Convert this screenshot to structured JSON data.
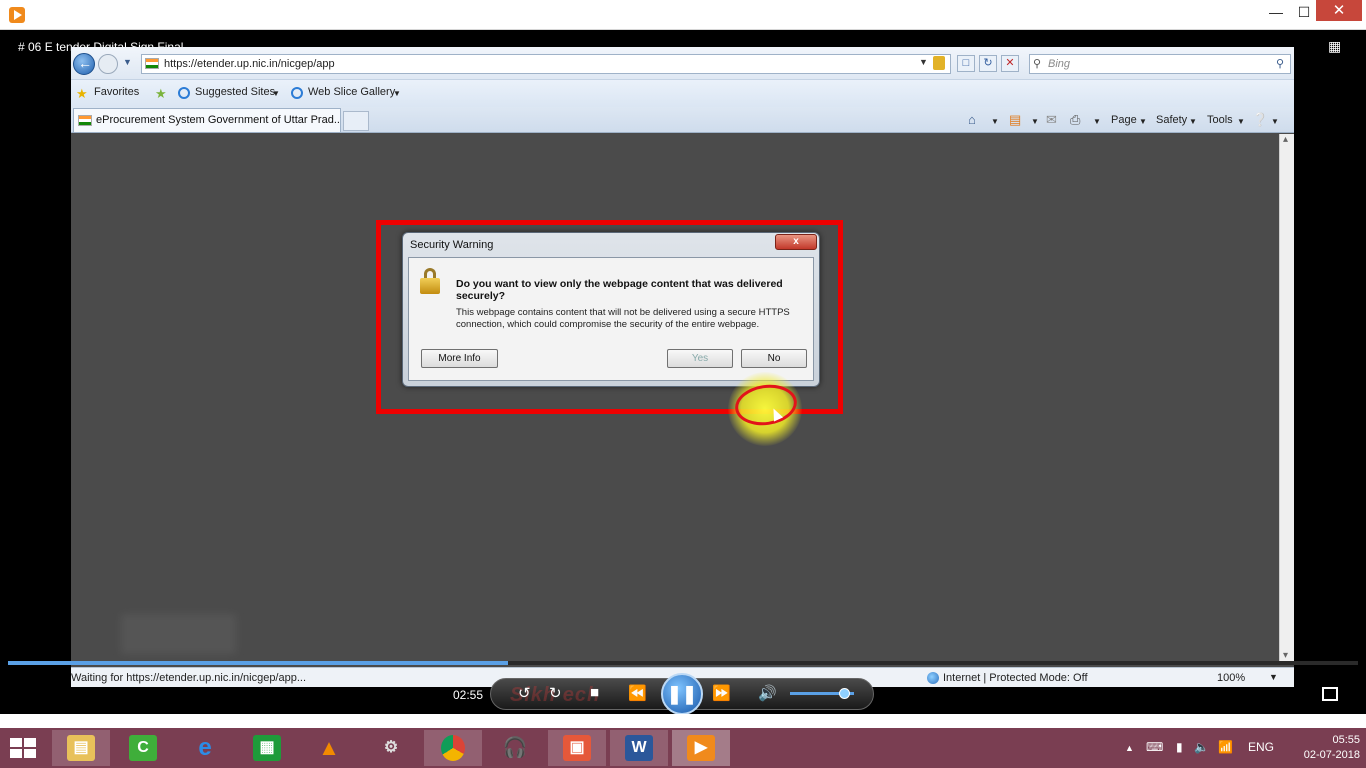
{
  "player": {
    "video_title": "# 06 E tender Digital Sign Final",
    "elapsed_time": "02:55",
    "watermark": "Sikh ech",
    "seek_progress_percent": 37,
    "volume_percent": 85,
    "icons": [
      "player-logo-icon",
      "minimize-icon",
      "maximize-icon",
      "close-icon",
      "fullscreen-icon",
      "rewind-icon",
      "repeat-icon",
      "stop-icon",
      "previous-icon",
      "pause-icon",
      "next-icon",
      "volume-icon",
      "exit-fullscreen-icon"
    ]
  },
  "browser": {
    "url": "https://etender.up.nic.in/nicgep/app",
    "search_placeholder": "Bing",
    "favorites": {
      "favorites_label": "Favorites",
      "suggested_sites": "Suggested Sites",
      "web_slice_gallery": "Web Slice Gallery"
    },
    "tab_title": "eProcurement System Government of Uttar Prad...",
    "command_bar": {
      "page": "Page",
      "safety": "Safety",
      "tools": "Tools"
    },
    "status": {
      "text": "Waiting for https://etender.up.nic.in/nicgep/app...",
      "zone": "Internet | Protected Mode: Off",
      "zoom": "100%"
    },
    "colors": {
      "flag_saffron": "#ff9933",
      "flag_green": "#138808",
      "content_bg": "#4b4b4b"
    }
  },
  "dialog": {
    "title": "Security Warning",
    "close_label": "x",
    "question": "Do you want to view only the webpage content that was delivered securely?",
    "description": "This webpage contains content that will not be delivered using a secure HTTPS connection, which could compromise the security of the entire webpage.",
    "buttons": {
      "more_info": "More Info",
      "yes": "Yes",
      "no": "No"
    },
    "highlight_color": "#ee0000"
  },
  "taskbar": {
    "apps": [
      "File Explorer",
      "Camtasia",
      "Internet Explorer",
      "Store",
      "VLC",
      "Network",
      "Google Chrome",
      "Audacity",
      "Presentation",
      "Word",
      "Video Player"
    ],
    "tray": {
      "language": "ENG"
    },
    "clock": {
      "time": "05:55",
      "date": "02-07-2018"
    },
    "accent_color": "#7a3e52"
  }
}
